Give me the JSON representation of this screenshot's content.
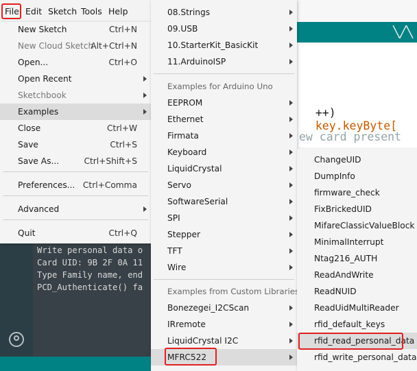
{
  "menubar": {
    "items": [
      "File",
      "Edit",
      "Sketch",
      "Tools",
      "Help"
    ]
  },
  "file_menu": {
    "items": [
      {
        "label": "New Sketch",
        "shortcut": "Ctrl+N"
      },
      {
        "label": "New Cloud Sketch",
        "shortcut": "Alt+Ctrl+N"
      },
      {
        "label": "Open...",
        "shortcut": "Ctrl+O"
      },
      {
        "label": "Open Recent",
        "shortcut": ""
      },
      {
        "label": "Sketchbook",
        "shortcut": ""
      },
      {
        "label": "Examples",
        "shortcut": ""
      },
      {
        "label": "Close",
        "shortcut": "Ctrl+W"
      },
      {
        "label": "Save",
        "shortcut": "Ctrl+S"
      },
      {
        "label": "Save As...",
        "shortcut": "Ctrl+Shift+S"
      },
      {
        "label": "Preferences...",
        "shortcut": "Ctrl+Comma"
      },
      {
        "label": "Advanced",
        "shortcut": ""
      },
      {
        "label": "Quit",
        "shortcut": "Ctrl+Q"
      }
    ]
  },
  "examples_menu": {
    "builtin_items": [
      "08.Strings",
      "09.USB",
      "10.StarterKit_BasicKit",
      "11.ArduinoISP"
    ],
    "board_section": "Examples for Arduino Uno",
    "board_items": [
      "EEPROM",
      "Ethernet",
      "Firmata",
      "Keyboard",
      "LiquidCrystal",
      "Servo",
      "SoftwareSerial",
      "SPI",
      "Stepper",
      "TFT",
      "Wire"
    ],
    "custom_section": "Examples from Custom Libraries",
    "custom_items": [
      "Bonezegei_I2CScan",
      "IRremote",
      "LiquidCrystal I2C",
      "MFRC522"
    ]
  },
  "mfrc522_menu": {
    "items": [
      "ChangeUID",
      "DumpInfo",
      "firmware_check",
      "FixBrickedUID",
      "MifareClassicValueBlock",
      "MinimalInterrupt",
      "Ntag216_AUTH",
      "ReadAndWrite",
      "ReadNUID",
      "ReadUidMultiReader",
      "rfid_default_keys",
      "rfid_read_personal_data",
      "rfid_write_personal_data"
    ]
  },
  "editor": {
    "line1_pre": "++)",
    "line1_kw": "key.keyByte[",
    "line2": "ew card present"
  },
  "console": {
    "lines": [
      "Write personal data o",
      "Card UID: 9B 2F 0A 11",
      "Type Family name, end",
      "PCD_Authenticate() fa"
    ]
  },
  "colors": {
    "accent": "#008184",
    "highlight_box": "#e02020"
  }
}
